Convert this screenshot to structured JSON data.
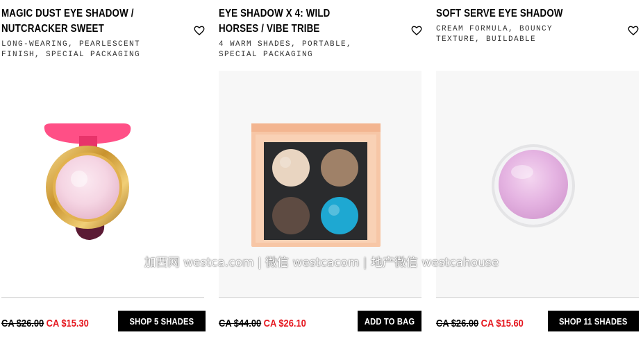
{
  "products": [
    {
      "title_line1": "MAGIC DUST EYE SHADOW /",
      "title_line2": "NUTCRACKER SWEET",
      "desc_line1": "LONG-WEARING, PEARLESCENT",
      "desc_line2": "FINISH, SPECIAL PACKAGING",
      "old_price": "CA $26.00",
      "sale_price": "CA $15.30",
      "button_label": "SHOP 5 SHADES",
      "icon": "heart-icon"
    },
    {
      "title_line1": "EYE SHADOW X 4: WILD",
      "title_line2": "HORSES / VIBE TRIBE",
      "desc_line1": "4 WARM SHADES, PORTABLE,",
      "desc_line2": "SPECIAL PACKAGING",
      "old_price": "CA $44.00",
      "sale_price": "CA $26.10",
      "button_label": "ADD TO BAG",
      "icon": "heart-icon"
    },
    {
      "title_line1": "SOFT SERVE EYE SHADOW",
      "title_line2": "",
      "desc_line1": "CREAM FORMULA, BOUNCY",
      "desc_line2": "TEXTURE, BUILDABLE",
      "old_price": "CA $26.00",
      "sale_price": "CA $15.60",
      "button_label": "SHOP 11 SHADES",
      "icon": "heart-icon"
    }
  ],
  "watermark": "加西网 westca.com | 微信 westcacom | 地产微信 westcahouse",
  "colors": {
    "sale_price": "#e5161e",
    "button_bg": "#000000",
    "button_text": "#ffffff",
    "divider": "#c8c8c8"
  }
}
